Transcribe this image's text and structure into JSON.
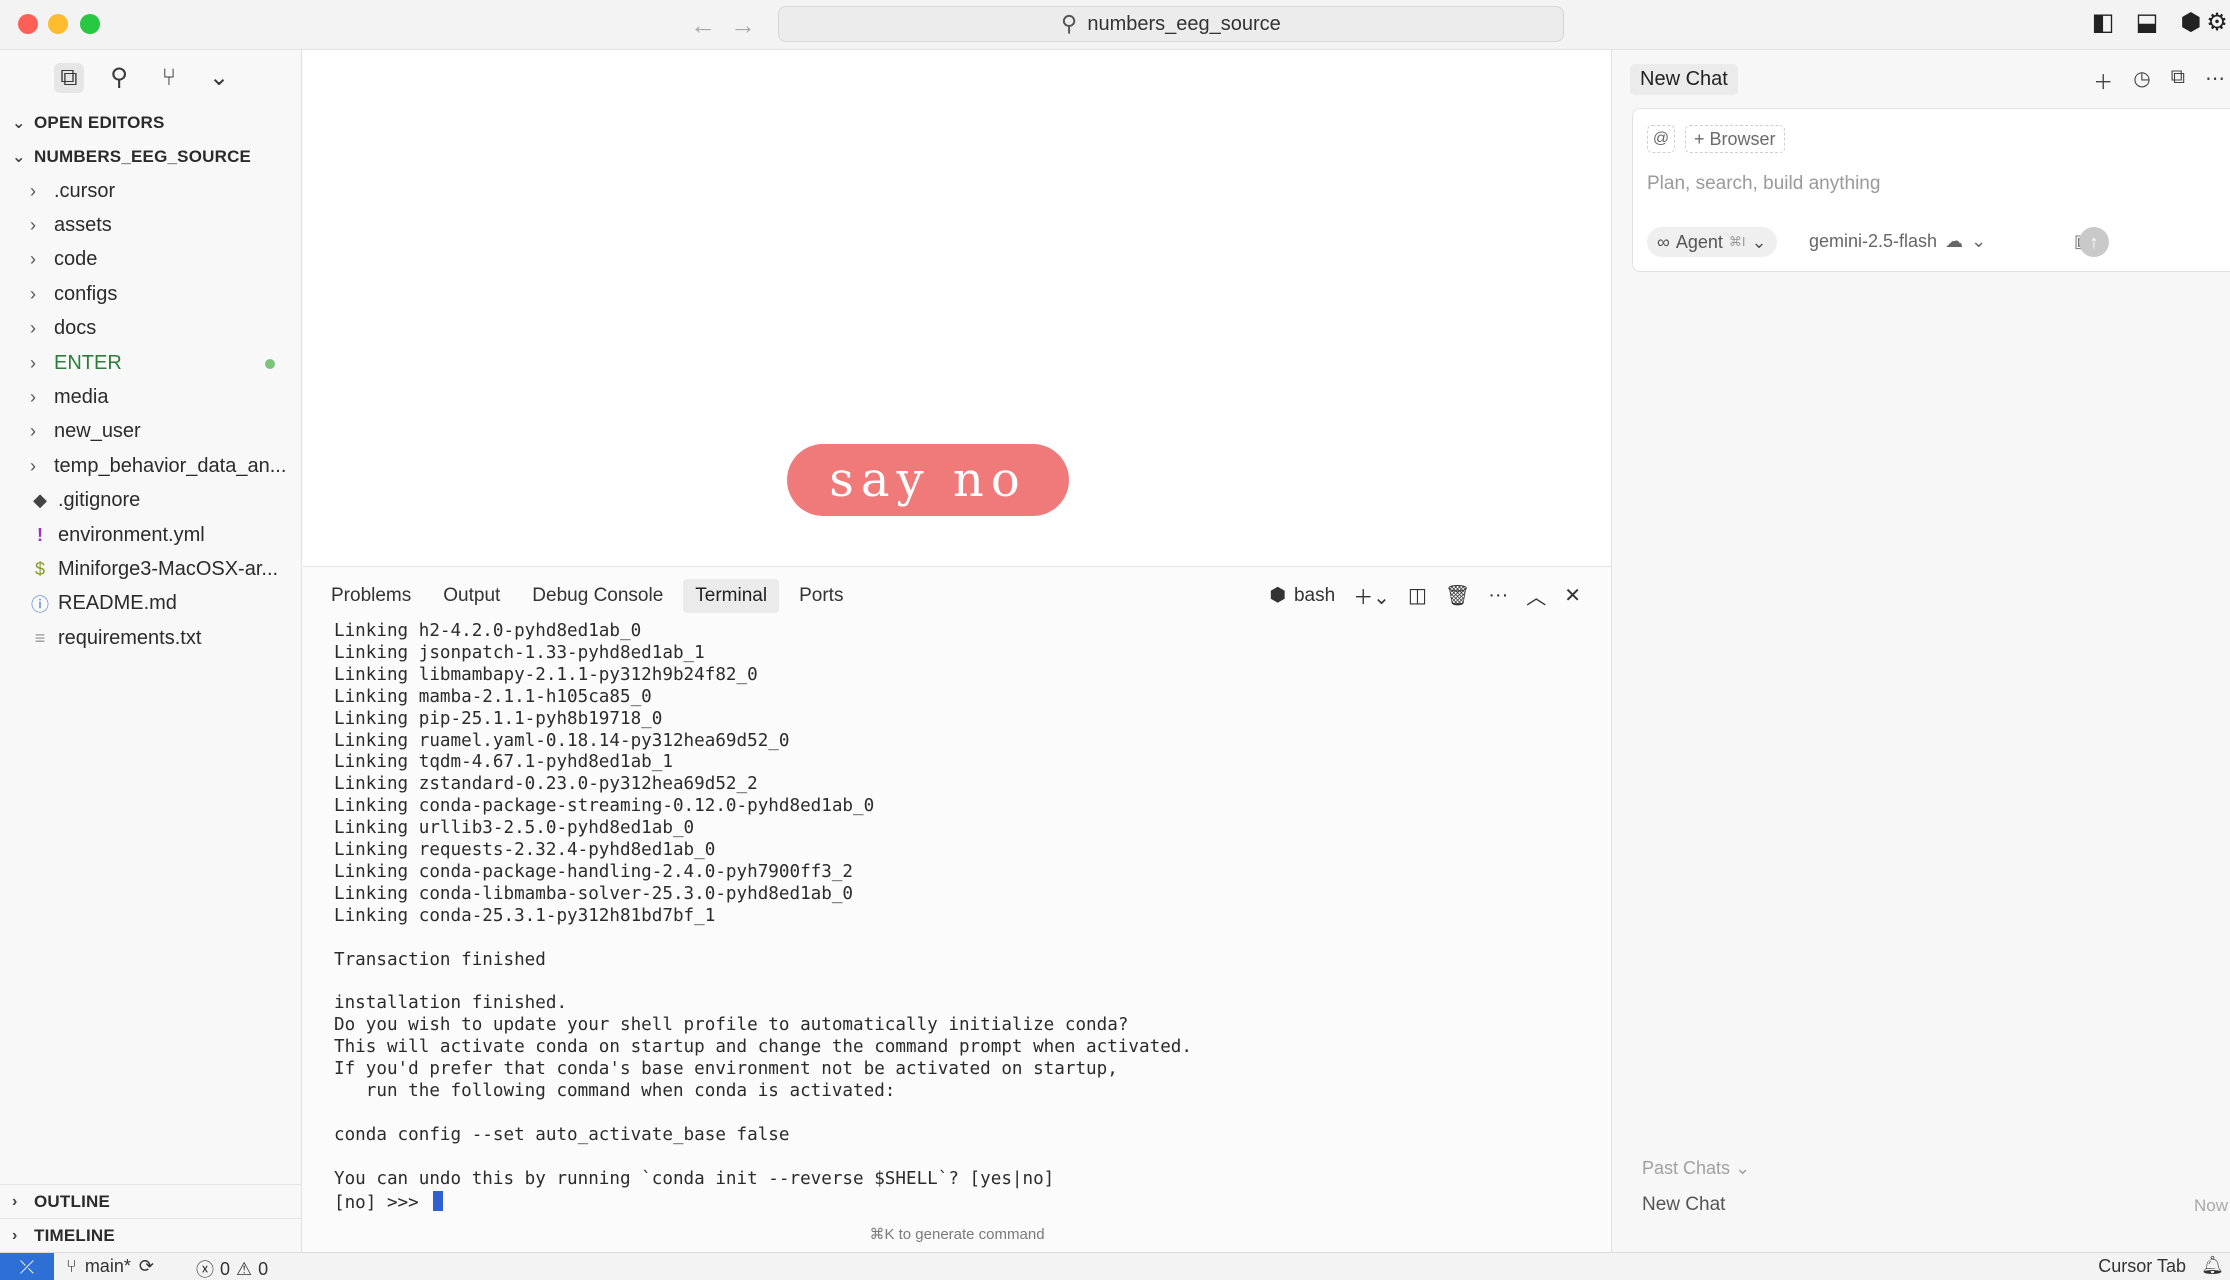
{
  "titlebar": {
    "search_text": "numbers_eeg_source",
    "back_icon": "←",
    "forward_icon": "→"
  },
  "sidebar": {
    "open_editors": "OPEN EDITORS",
    "project": "NUMBERS_EEG_SOURCE",
    "folders": [
      ".cursor",
      "assets",
      "code",
      "configs",
      "docs",
      "ENTER",
      "media",
      "new_user",
      "temp_behavior_data_an..."
    ],
    "files": [
      {
        "name": ".gitignore",
        "icon": "◆"
      },
      {
        "name": "environment.yml",
        "icon": "!"
      },
      {
        "name": "Miniforge3-MacOSX-ar...",
        "icon": "$"
      },
      {
        "name": "README.md",
        "icon": "ⓘ"
      },
      {
        "name": "requirements.txt",
        "icon": "≡"
      }
    ],
    "outline": "OUTLINE",
    "timeline": "TIMELINE"
  },
  "editor": {
    "pill_text": "say no",
    "pill_color": "#f07a7a"
  },
  "panel": {
    "tabs": [
      "Problems",
      "Output",
      "Debug Console",
      "Terminal",
      "Ports"
    ],
    "shell": "bash",
    "terminal_lines": [
      "Linking h2-4.2.0-pyhd8ed1ab_0",
      "Linking jsonpatch-1.33-pyhd8ed1ab_1",
      "Linking libmambapy-2.1.1-py312h9b24f82_0",
      "Linking mamba-2.1.1-h105ca85_0",
      "Linking pip-25.1.1-pyh8b19718_0",
      "Linking ruamel.yaml-0.18.14-py312hea69d52_0",
      "Linking tqdm-4.67.1-pyhd8ed1ab_1",
      "Linking zstandard-0.23.0-py312hea69d52_2",
      "Linking conda-package-streaming-0.12.0-pyhd8ed1ab_0",
      "Linking urllib3-2.5.0-pyhd8ed1ab_0",
      "Linking requests-2.32.4-pyhd8ed1ab_0",
      "Linking conda-package-handling-2.4.0-pyh7900ff3_2",
      "Linking conda-libmamba-solver-25.3.0-pyhd8ed1ab_0",
      "Linking conda-25.3.1-py312h81bd7bf_1",
      "",
      "Transaction finished",
      "",
      "installation finished.",
      "Do you wish to update your shell profile to automatically initialize conda?",
      "This will activate conda on startup and change the command prompt when activated.",
      "If you'd prefer that conda's base environment not be activated on startup,",
      "   run the following command when conda is activated:",
      "",
      "conda config --set auto_activate_base false",
      "",
      "You can undo this by running `conda init --reverse $SHELL`? [yes|no]"
    ],
    "prompt": "[no] >>> ",
    "generate_hint": "⌘K to generate command"
  },
  "chat": {
    "title": "New Chat",
    "at_chip": "@",
    "browser_chip": "+ Browser",
    "placeholder": "Plan, search, build anything",
    "agent_label": "Agent",
    "agent_shortcut": "⌘I",
    "model": "gemini-2.5-flash",
    "past_chats": "Past Chats",
    "past_items": [
      {
        "title": "New Chat",
        "time": "Now"
      }
    ]
  },
  "statusbar": {
    "branch": "main*",
    "errors": "0",
    "warnings": "0",
    "right_label": "Cursor Tab"
  },
  "colors": {
    "remote_accent": "#2e6fd6",
    "modified_git": "#2d7d3c",
    "cursor_block": "#2f5fd0"
  }
}
